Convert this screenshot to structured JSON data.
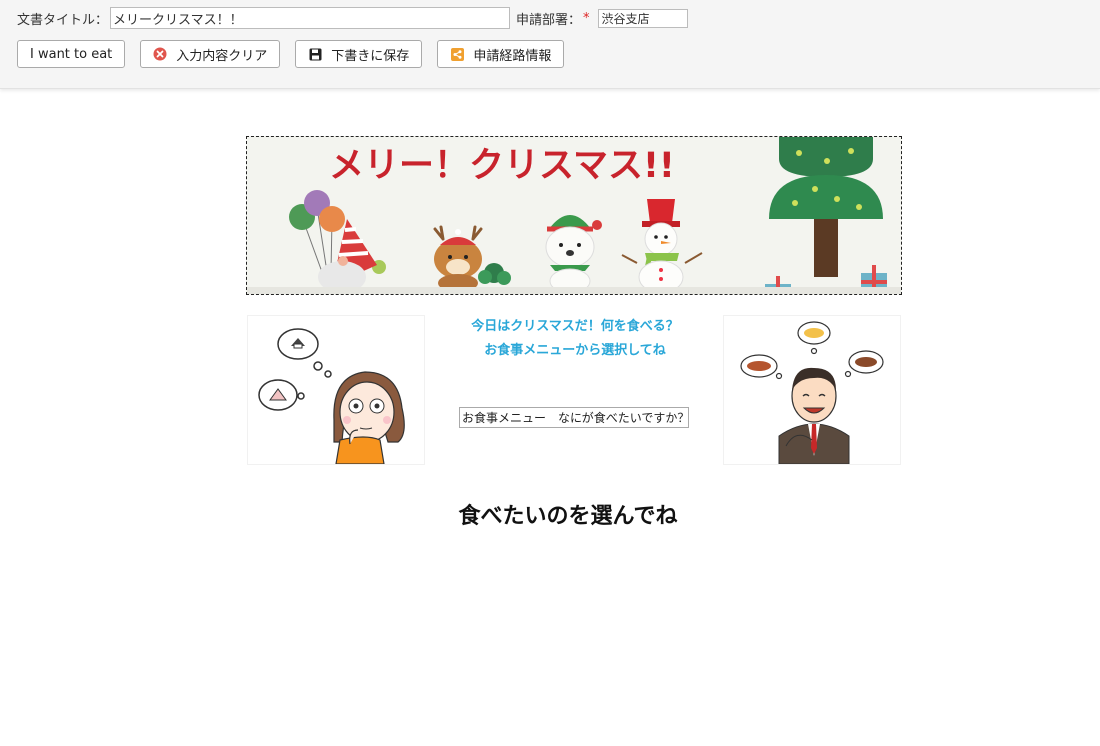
{
  "form": {
    "title_label": "文書タイトル：",
    "title_value": "メリークリスマス！！",
    "dept_label": "申請部署：",
    "required_mark": "*",
    "dept_value": "渋谷支店"
  },
  "toolbar": {
    "eat_label": "I want to eat",
    "clear_label": "入力内容クリア",
    "save_label": "下書きに保存",
    "route_label": "申請経路情報"
  },
  "banner": {
    "text": "メリー！クリスマス!!"
  },
  "message": {
    "line1": "今日はクリスマスだ！何を食べる？",
    "line2": "お食事メニューから選択してね"
  },
  "menu": {
    "selected": "お食事メニュー　なにが食べたいですか？"
  },
  "section": {
    "title": "食べたいのを選んでね"
  },
  "colors": {
    "accent_text": "#2aa7d8",
    "clear_icon": "#e0554d",
    "route_icon": "#f0a030",
    "banner_title": "#c8232c"
  },
  "icons": {
    "clear": "clear-x-icon",
    "save": "floppy-disk-icon",
    "route": "share-route-icon"
  }
}
